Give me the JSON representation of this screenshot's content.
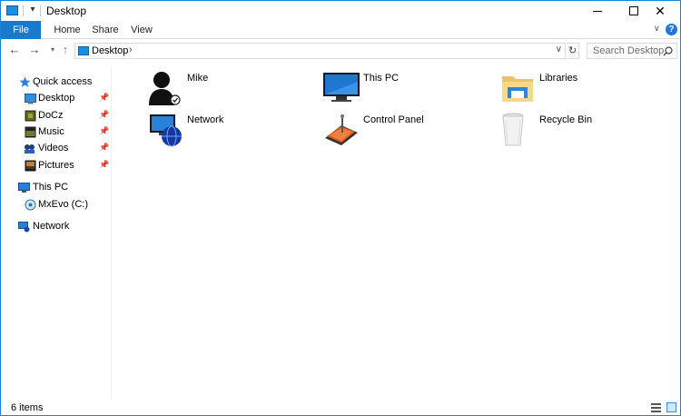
{
  "window": {
    "title": "Desktop",
    "colors": {
      "accent": "#1979ca",
      "border": "#1883d7"
    }
  },
  "ribbon": {
    "tabs": [
      {
        "label": "File",
        "active": true
      },
      {
        "label": "Home"
      },
      {
        "label": "Share"
      },
      {
        "label": "View"
      }
    ],
    "help_label": "?"
  },
  "address": {
    "path": "Desktop",
    "search_placeholder": "Search Desktop"
  },
  "nav_pane": {
    "items": [
      {
        "label": "Quick access",
        "icon": "star-icon",
        "pinned": false
      },
      {
        "label": "Desktop",
        "icon": "desktop-folder-icon",
        "pinned": true
      },
      {
        "label": "DoCz",
        "icon": "docz-folder-icon",
        "pinned": true
      },
      {
        "label": "Music",
        "icon": "music-folder-icon",
        "pinned": true
      },
      {
        "label": "Videos",
        "icon": "videos-folder-icon",
        "pinned": true
      },
      {
        "label": "Pictures",
        "icon": "pictures-folder-icon",
        "pinned": true
      },
      {
        "label": "This PC",
        "icon": "this-pc-icon",
        "pinned": false
      },
      {
        "label": "MxEvo (C:)",
        "icon": "drive-icon",
        "pinned": false
      },
      {
        "label": "Network",
        "icon": "network-icon",
        "pinned": false
      }
    ]
  },
  "content": {
    "items": [
      {
        "label": "Mike",
        "icon": "user-icon"
      },
      {
        "label": "This PC",
        "icon": "monitor-icon"
      },
      {
        "label": "Libraries",
        "icon": "libraries-icon"
      },
      {
        "label": "Network",
        "icon": "network-globe-icon"
      },
      {
        "label": "Control Panel",
        "icon": "control-panel-icon"
      },
      {
        "label": "Recycle Bin",
        "icon": "recycle-bin-icon"
      }
    ]
  },
  "status": {
    "item_count": "6 items"
  }
}
